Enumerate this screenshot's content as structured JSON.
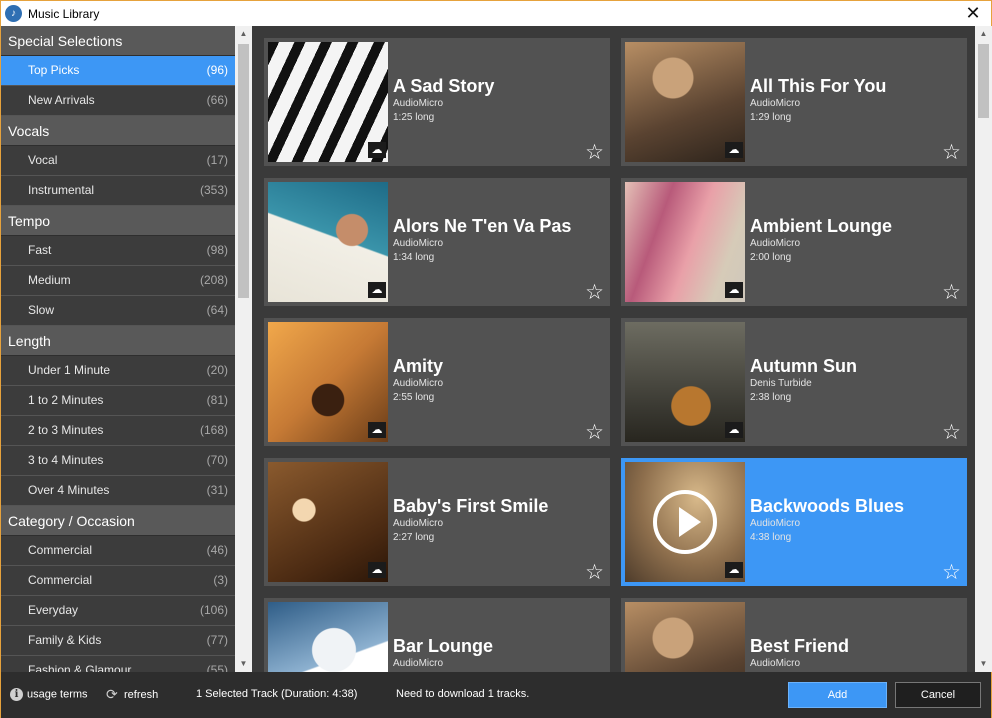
{
  "window": {
    "title": "Music Library",
    "app_icon": "music-library-logo-icon",
    "close_glyph": "✕"
  },
  "sidebar": {
    "sections": [
      {
        "header": "Special Selections",
        "items": [
          {
            "label": "Top Picks",
            "count": "(96)",
            "selected": true
          },
          {
            "label": "New Arrivals",
            "count": "(66)"
          }
        ]
      },
      {
        "header": "Vocals",
        "items": [
          {
            "label": "Vocal",
            "count": "(17)"
          },
          {
            "label": "Instrumental",
            "count": "(353)"
          }
        ]
      },
      {
        "header": "Tempo",
        "items": [
          {
            "label": "Fast",
            "count": "(98)"
          },
          {
            "label": "Medium",
            "count": "(208)"
          },
          {
            "label": "Slow",
            "count": "(64)"
          }
        ]
      },
      {
        "header": "Length",
        "items": [
          {
            "label": "Under 1 Minute",
            "count": "(20)"
          },
          {
            "label": "1 to 2 Minutes",
            "count": "(81)"
          },
          {
            "label": "2 to 3 Minutes",
            "count": "(168)"
          },
          {
            "label": "3 to 4 Minutes",
            "count": "(70)"
          },
          {
            "label": "Over 4 Minutes",
            "count": "(31)"
          }
        ]
      },
      {
        "header": "Category / Occasion",
        "items": [
          {
            "label": "Commercial",
            "count": "(46)"
          },
          {
            "label": "Commercial",
            "count": "(3)"
          },
          {
            "label": "Everyday",
            "count": "(106)"
          },
          {
            "label": "Family & Kids",
            "count": "(77)"
          },
          {
            "label": "Fashion & Glamour",
            "count": "(55)"
          }
        ]
      }
    ]
  },
  "tracks": [
    {
      "title": "A Sad Story",
      "artist": "AudioMicro",
      "length": "1:25 long",
      "art": "piano"
    },
    {
      "title": "All This For You",
      "artist": "AudioMicro",
      "length": "1:29 long",
      "art": "guitarman"
    },
    {
      "title": "Alors Ne T'en Va Pas",
      "artist": "AudioMicro",
      "length": "1:34 long",
      "art": "trumpet"
    },
    {
      "title": "Ambient Lounge",
      "artist": "AudioMicro",
      "length": "2:00 long",
      "art": "ambient"
    },
    {
      "title": "Amity",
      "artist": "AudioMicro",
      "length": "2:55 long",
      "art": "amity"
    },
    {
      "title": "Autumn Sun",
      "artist": "Denis Turbide",
      "length": "2:38 long",
      "art": "autumn"
    },
    {
      "title": "Baby's First Smile",
      "artist": "AudioMicro",
      "length": "2:27 long",
      "art": "baby"
    },
    {
      "title": "Backwoods Blues",
      "artist": "AudioMicro",
      "length": "4:38 long",
      "art": "backwoods",
      "selected": true
    },
    {
      "title": "Bar Lounge",
      "artist": "AudioMicro",
      "length": "",
      "art": "barlounge"
    },
    {
      "title": "Best Friend",
      "artist": "AudioMicro",
      "length": "",
      "art": "bestfriend"
    }
  ],
  "icons": {
    "cloud": "☁",
    "star": "☆",
    "play": "play-icon"
  },
  "footer": {
    "usage_terms": "usage terms",
    "refresh": "refresh",
    "selection_status": "1 Selected Track (Duration: 4:38)",
    "download_status": "Need to download 1 tracks.",
    "add_label": "Add",
    "cancel_label": "Cancel"
  },
  "colors": {
    "accent": "#3d97f5",
    "panel": "#525252",
    "background": "#3a3a3a"
  }
}
